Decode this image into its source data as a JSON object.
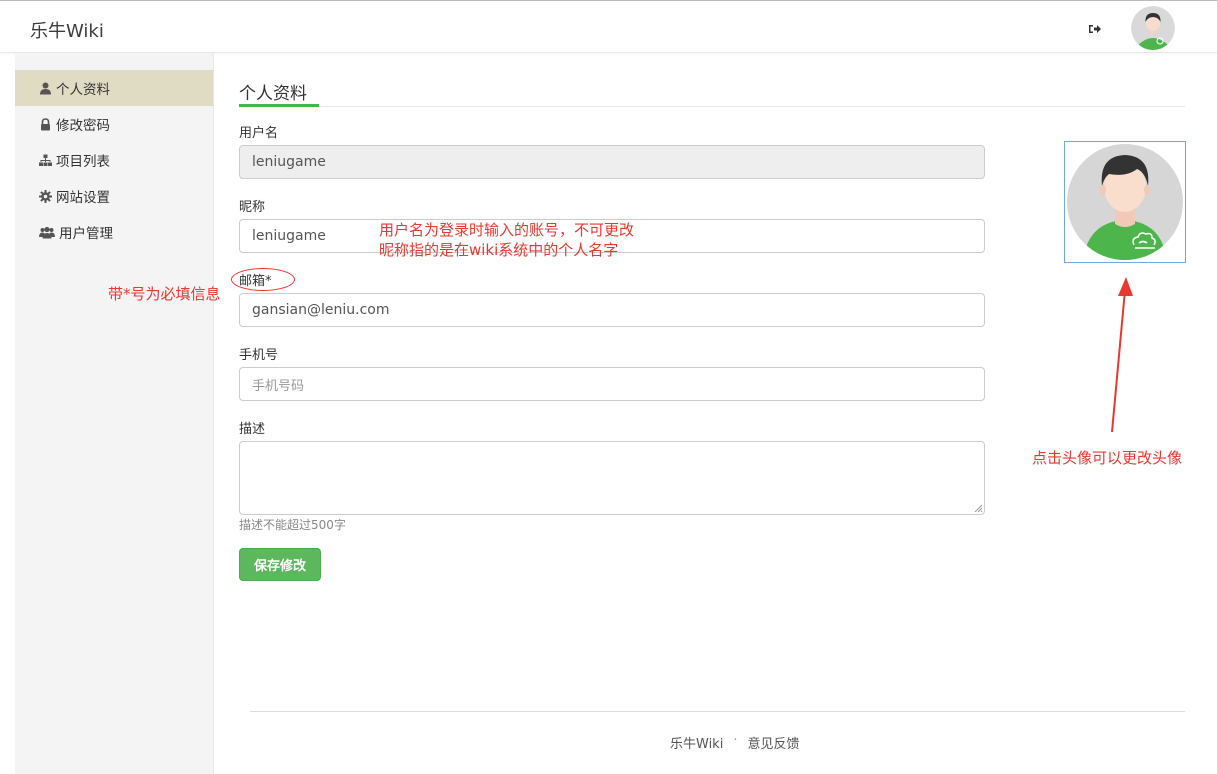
{
  "header": {
    "brand": "乐牛Wiki",
    "logout_icon": "sign-out-icon"
  },
  "sidebar": {
    "items": [
      {
        "label": "个人资料",
        "icon": "user-icon",
        "active": true
      },
      {
        "label": "修改密码",
        "icon": "lock-icon",
        "active": false
      },
      {
        "label": "项目列表",
        "icon": "sitemap-icon",
        "active": false
      },
      {
        "label": "网站设置",
        "icon": "gear-icon",
        "active": false
      },
      {
        "label": "用户管理",
        "icon": "users-icon",
        "active": false
      }
    ]
  },
  "main": {
    "title": "个人资料",
    "username_label": "用户名",
    "username_value": "leniugame",
    "nickname_label": "昵称",
    "nickname_value": "leniugame",
    "email_label": "邮箱*",
    "email_value": "gansian@leniu.com",
    "phone_label": "手机号",
    "phone_placeholder": "手机号码",
    "desc_label": "描述",
    "desc_help": "描述不能超过500字",
    "save_label": "保存修改"
  },
  "annotations": {
    "nickname_note_1": "用户名为登录时输入的账号，不可更改",
    "nickname_note_2": "昵称指的是在wiki系统中的个人名字",
    "required_note": "带*号为必填信息",
    "avatar_note": "点击头像可以更改头像"
  },
  "footer": {
    "brand": "乐牛Wiki",
    "separator": "·",
    "feedback": "意见反馈"
  },
  "colors": {
    "accent_green": "#44b549",
    "button_green": "#5cb85c",
    "annotation_red": "#e8382f",
    "sidebar_active": "#e0dcc3"
  }
}
